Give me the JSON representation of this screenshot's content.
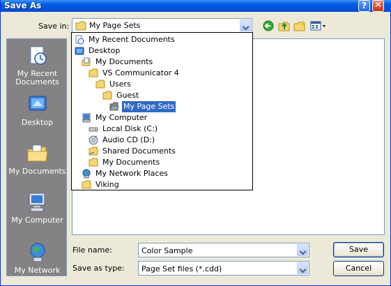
{
  "window": {
    "title": "Save As",
    "help_glyph": "?",
    "close_glyph": "✕"
  },
  "toolbar": {
    "save_in_label": "Save in:",
    "save_in_value": "My Page Sets"
  },
  "places": [
    {
      "label": "My Recent Documents",
      "icon": "recent-documents-icon"
    },
    {
      "label": "Desktop",
      "icon": "desktop-icon"
    },
    {
      "label": "My Documents",
      "icon": "my-documents-icon"
    },
    {
      "label": "My Computer",
      "icon": "my-computer-icon"
    },
    {
      "label": "My Network",
      "icon": "my-network-icon"
    }
  ],
  "dropdown": {
    "items": [
      {
        "label": "My Recent Documents",
        "icon": "recent-documents-icon",
        "level": 0
      },
      {
        "label": "Desktop",
        "icon": "desktop-icon",
        "level": 0
      },
      {
        "label": "My Documents",
        "icon": "my-documents-icon",
        "level": 1
      },
      {
        "label": "VS Communicator 4",
        "icon": "folder-icon",
        "level": 2
      },
      {
        "label": "Users",
        "icon": "folder-icon",
        "level": 3
      },
      {
        "label": "Guest",
        "icon": "folder-icon",
        "level": 4
      },
      {
        "label": "My Page Sets",
        "icon": "open-folder-icon",
        "level": 5,
        "selected": true
      },
      {
        "label": "My Computer",
        "icon": "my-computer-icon",
        "level": 1
      },
      {
        "label": "Local Disk (C:)",
        "icon": "hard-disk-icon",
        "level": 2
      },
      {
        "label": "Audio CD (D:)",
        "icon": "cd-drive-icon",
        "level": 2
      },
      {
        "label": "Shared Documents",
        "icon": "shared-folder-icon",
        "level": 2
      },
      {
        "label": "My Documents",
        "icon": "folder-icon",
        "level": 2
      },
      {
        "label": "My Network Places",
        "icon": "network-places-icon",
        "level": 1
      },
      {
        "label": "Viking",
        "icon": "folder-icon",
        "level": 1
      }
    ]
  },
  "form": {
    "file_name_label": "File name:",
    "file_name_value": "Color Sample",
    "save_as_type_label": "Save as type:",
    "save_as_type_value": "Page Set files (*.cdd)"
  },
  "buttons": {
    "save": "Save",
    "cancel": "Cancel"
  },
  "colors": {
    "titlebar": "#0055e5",
    "selection": "#316ac5",
    "places_bg": "#848284",
    "dialog_bg": "#ece9d8"
  }
}
